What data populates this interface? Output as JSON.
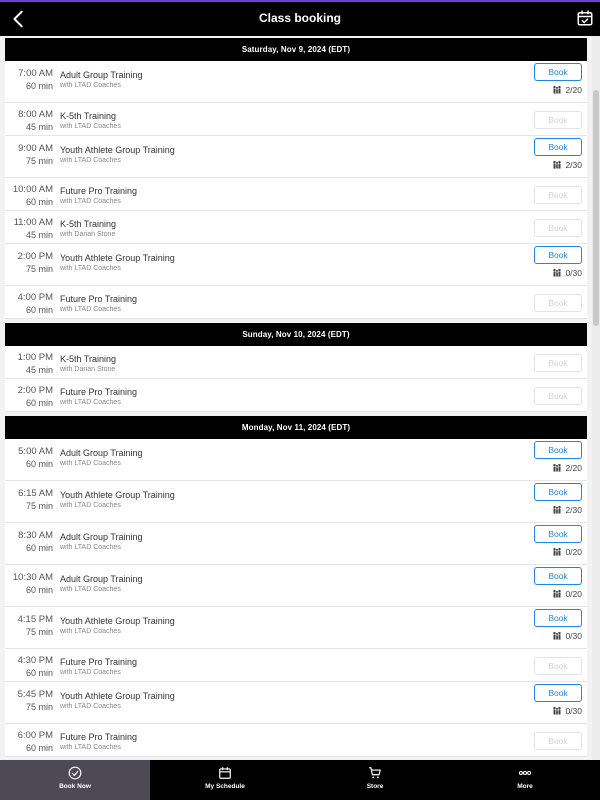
{
  "header": {
    "title": "Class booking"
  },
  "labels": {
    "book": "Book"
  },
  "days": [
    {
      "date": "Saturday, Nov 9, 2024 (EDT)",
      "classes": [
        {
          "time": "7:00 AM",
          "duration": "60 min",
          "name": "Adult Group Training",
          "coach": "with LTAD Coaches",
          "bookable": true,
          "capacity": "2/20"
        },
        {
          "time": "8:00 AM",
          "duration": "45 min",
          "name": "K-5th Training",
          "coach": "with LTAD Coaches",
          "bookable": false
        },
        {
          "time": "9:00 AM",
          "duration": "75 min",
          "name": "Youth Athlete Group Training",
          "coach": "with LTAD Coaches",
          "bookable": true,
          "capacity": "2/30"
        },
        {
          "time": "10:00 AM",
          "duration": "60 min",
          "name": "Future Pro Training",
          "coach": "with LTAD Coaches",
          "bookable": false
        },
        {
          "time": "11:00 AM",
          "duration": "45 min",
          "name": "K-5th Training",
          "coach": "with Darian Stone",
          "bookable": false
        },
        {
          "time": "2:00 PM",
          "duration": "75 min",
          "name": "Youth Athlete Group Training",
          "coach": "with LTAD Coaches",
          "bookable": true,
          "capacity": "0/30"
        },
        {
          "time": "4:00 PM",
          "duration": "60 min",
          "name": "Future Pro Training",
          "coach": "with LTAD Coaches",
          "bookable": false
        }
      ]
    },
    {
      "date": "Sunday, Nov 10, 2024 (EDT)",
      "classes": [
        {
          "time": "1:00 PM",
          "duration": "45 min",
          "name": "K-5th Training",
          "coach": "with Darian Stone",
          "bookable": false
        },
        {
          "time": "2:00 PM",
          "duration": "60 min",
          "name": "Future Pro Training",
          "coach": "with LTAD Coaches",
          "bookable": false
        }
      ]
    },
    {
      "date": "Monday, Nov 11, 2024 (EDT)",
      "classes": [
        {
          "time": "5:00 AM",
          "duration": "60 min",
          "name": "Adult Group Training",
          "coach": "with LTAD Coaches",
          "bookable": true,
          "capacity": "2/20"
        },
        {
          "time": "6:15 AM",
          "duration": "75 min",
          "name": "Youth Athlete Group Training",
          "coach": "with LTAD Coaches",
          "bookable": true,
          "capacity": "2/30"
        },
        {
          "time": "8:30 AM",
          "duration": "60 min",
          "name": "Adult Group Training",
          "coach": "with LTAD Coaches",
          "bookable": true,
          "capacity": "0/20"
        },
        {
          "time": "10:30 AM",
          "duration": "60 min",
          "name": "Adult Group Training",
          "coach": "with LTAD Coaches",
          "bookable": true,
          "capacity": "0/20"
        },
        {
          "time": "4:15 PM",
          "duration": "75 min",
          "name": "Youth Athlete Group Training",
          "coach": "with LTAD Coaches",
          "bookable": true,
          "capacity": "0/30"
        },
        {
          "time": "4:30 PM",
          "duration": "60 min",
          "name": "Future Pro Training",
          "coach": "with LTAD Coaches",
          "bookable": false
        },
        {
          "time": "5:45 PM",
          "duration": "75 min",
          "name": "Youth Athlete Group Training",
          "coach": "with LTAD Coaches",
          "bookable": true,
          "capacity": "0/30"
        },
        {
          "time": "6:00 PM",
          "duration": "60 min",
          "name": "Future Pro Training",
          "coach": "with LTAD Coaches",
          "bookable": false
        }
      ]
    }
  ],
  "bottom_nav": [
    {
      "label": "Book Now",
      "icon": "check-circle-icon",
      "active": true
    },
    {
      "label": "My Schedule",
      "icon": "calendar-icon",
      "active": false
    },
    {
      "label": "Store",
      "icon": "cart-icon",
      "active": false
    },
    {
      "label": "More",
      "icon": "more-dots-icon",
      "active": false
    }
  ],
  "colors": {
    "accent": "#1e88e5",
    "header_bg": "#000000",
    "nav_active": "#4d4a55"
  }
}
